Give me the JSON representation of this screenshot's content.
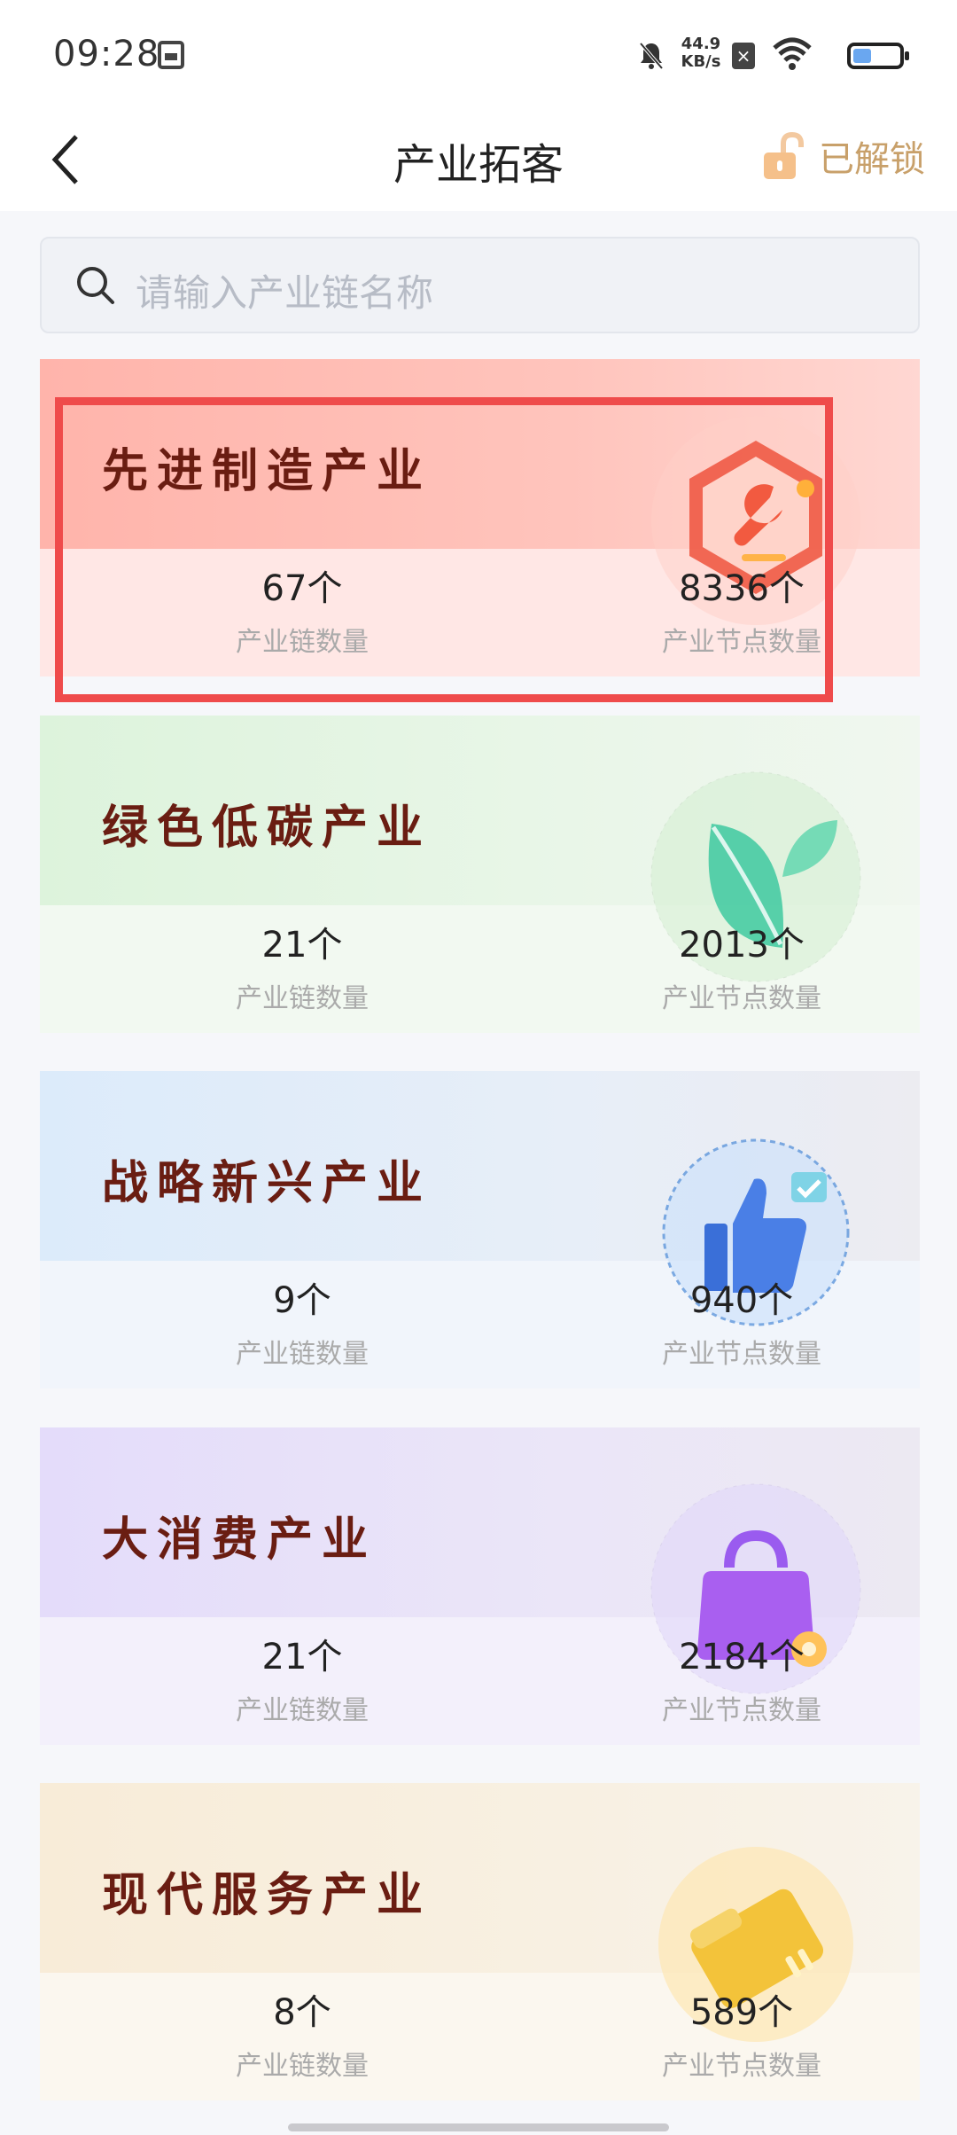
{
  "status_bar": {
    "time": "09:28",
    "net_speed_value": "44.9",
    "net_speed_unit": "KB/s",
    "sim_icon_text": "×"
  },
  "nav": {
    "title": "产业拓客",
    "unlock_label": "已解锁"
  },
  "search": {
    "placeholder": "请输入产业链名称"
  },
  "cards": [
    {
      "title": "先进制造产业",
      "chain_count": "67个",
      "chain_label": "产业链数量",
      "node_count": "8336个",
      "node_label": "产业节点数量",
      "icon": "wrench-icon"
    },
    {
      "title": "绿色低碳产业",
      "chain_count": "21个",
      "chain_label": "产业链数量",
      "node_count": "2013个",
      "node_label": "产业节点数量",
      "icon": "leaf-icon"
    },
    {
      "title": "战略新兴产业",
      "chain_count": "9个",
      "chain_label": "产业链数量",
      "node_count": "940个",
      "node_label": "产业节点数量",
      "icon": "thumbs-up-icon"
    },
    {
      "title": "大消费产业",
      "chain_count": "21个",
      "chain_label": "产业链数量",
      "node_count": "2184个",
      "node_label": "产业节点数量",
      "icon": "shopping-bag-icon"
    },
    {
      "title": "现代服务产业",
      "chain_count": "8个",
      "chain_label": "产业链数量",
      "node_count": "589个",
      "node_label": "产业节点数量",
      "icon": "folder-icon"
    }
  ],
  "colors": {
    "title_text": "#6a1d12",
    "accent_unlock": "#c8a06a",
    "highlight": "#ef4b4b"
  }
}
